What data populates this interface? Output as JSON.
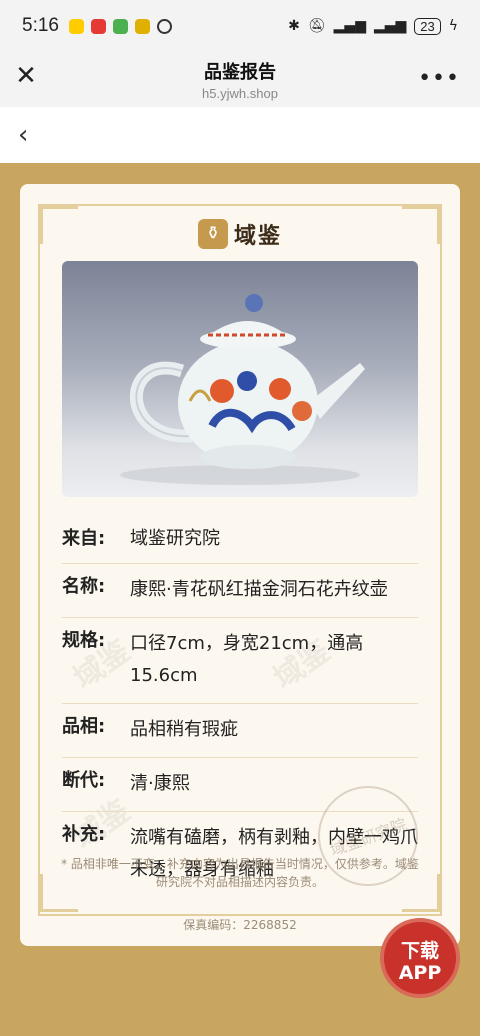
{
  "status_bar": {
    "time": "5:16",
    "battery": "23",
    "app_icons": [
      "#ffcc00",
      "#e53935",
      "#4caf50",
      "#e0b000"
    ]
  },
  "wechat_nav": {
    "title": "品鉴报告",
    "url": "h5.yjwh.shop",
    "close_icon": "close-icon",
    "more_icon": "more-icon"
  },
  "page": {
    "back_icon": "chevron-left-icon"
  },
  "brand": {
    "name": "域鉴",
    "logo_icon": "vase-logo-icon"
  },
  "report": {
    "rows": [
      {
        "label": "来自:",
        "value": "域鉴研究院"
      },
      {
        "label": "名称:",
        "value": "康熙·青花矾红描金洞石花卉纹壶"
      },
      {
        "label": "规格:",
        "value": "口径7cm，身宽21cm，通高15.6cm"
      },
      {
        "label": "品相:",
        "value": "品相稍有瑕疵"
      },
      {
        "label": "断代:",
        "value": "清·康熙"
      },
      {
        "label": "补充:",
        "value": "流嘴有磕磨，柄有剥釉，内壁一鸡爪未透，器身有缩釉"
      }
    ],
    "disclaimer": "* 品相非唯一不变，补充内容为出具报告当时情况，仅供参考。域鉴研究院不对品相描述内容负责。",
    "code_label": "保真编码：2268852"
  },
  "download_button": {
    "line1": "下载",
    "line2": "APP"
  },
  "colors": {
    "gold_background": "#c9a660",
    "card_background": "#fdf8ef",
    "download_red": "#c9312b"
  }
}
